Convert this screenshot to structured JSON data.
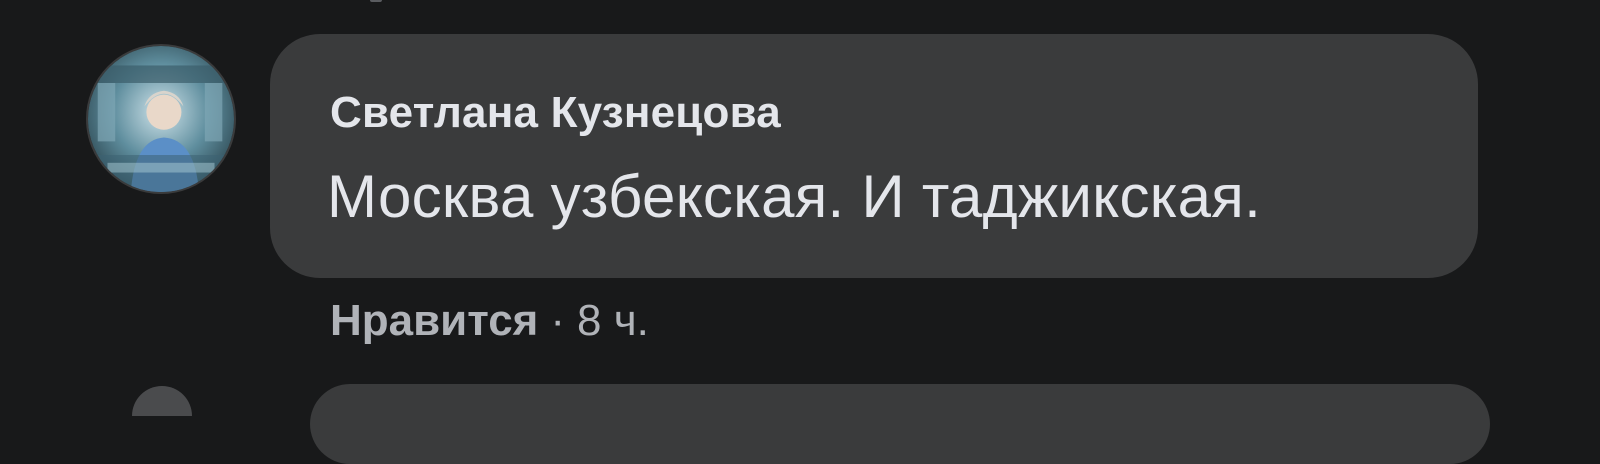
{
  "comment": {
    "author": "Светлана Кузнецова",
    "text": "Москва узбекская. И таджикская.",
    "avatar_icon": "user-avatar-photo"
  },
  "actions": {
    "like_label": "Нравится",
    "separator": "·",
    "time_label": "8 ч."
  },
  "colors": {
    "background": "#18191a",
    "bubble": "#3a3b3c",
    "primary_text": "#e4e6eb",
    "secondary_text": "#b0b3b8"
  }
}
